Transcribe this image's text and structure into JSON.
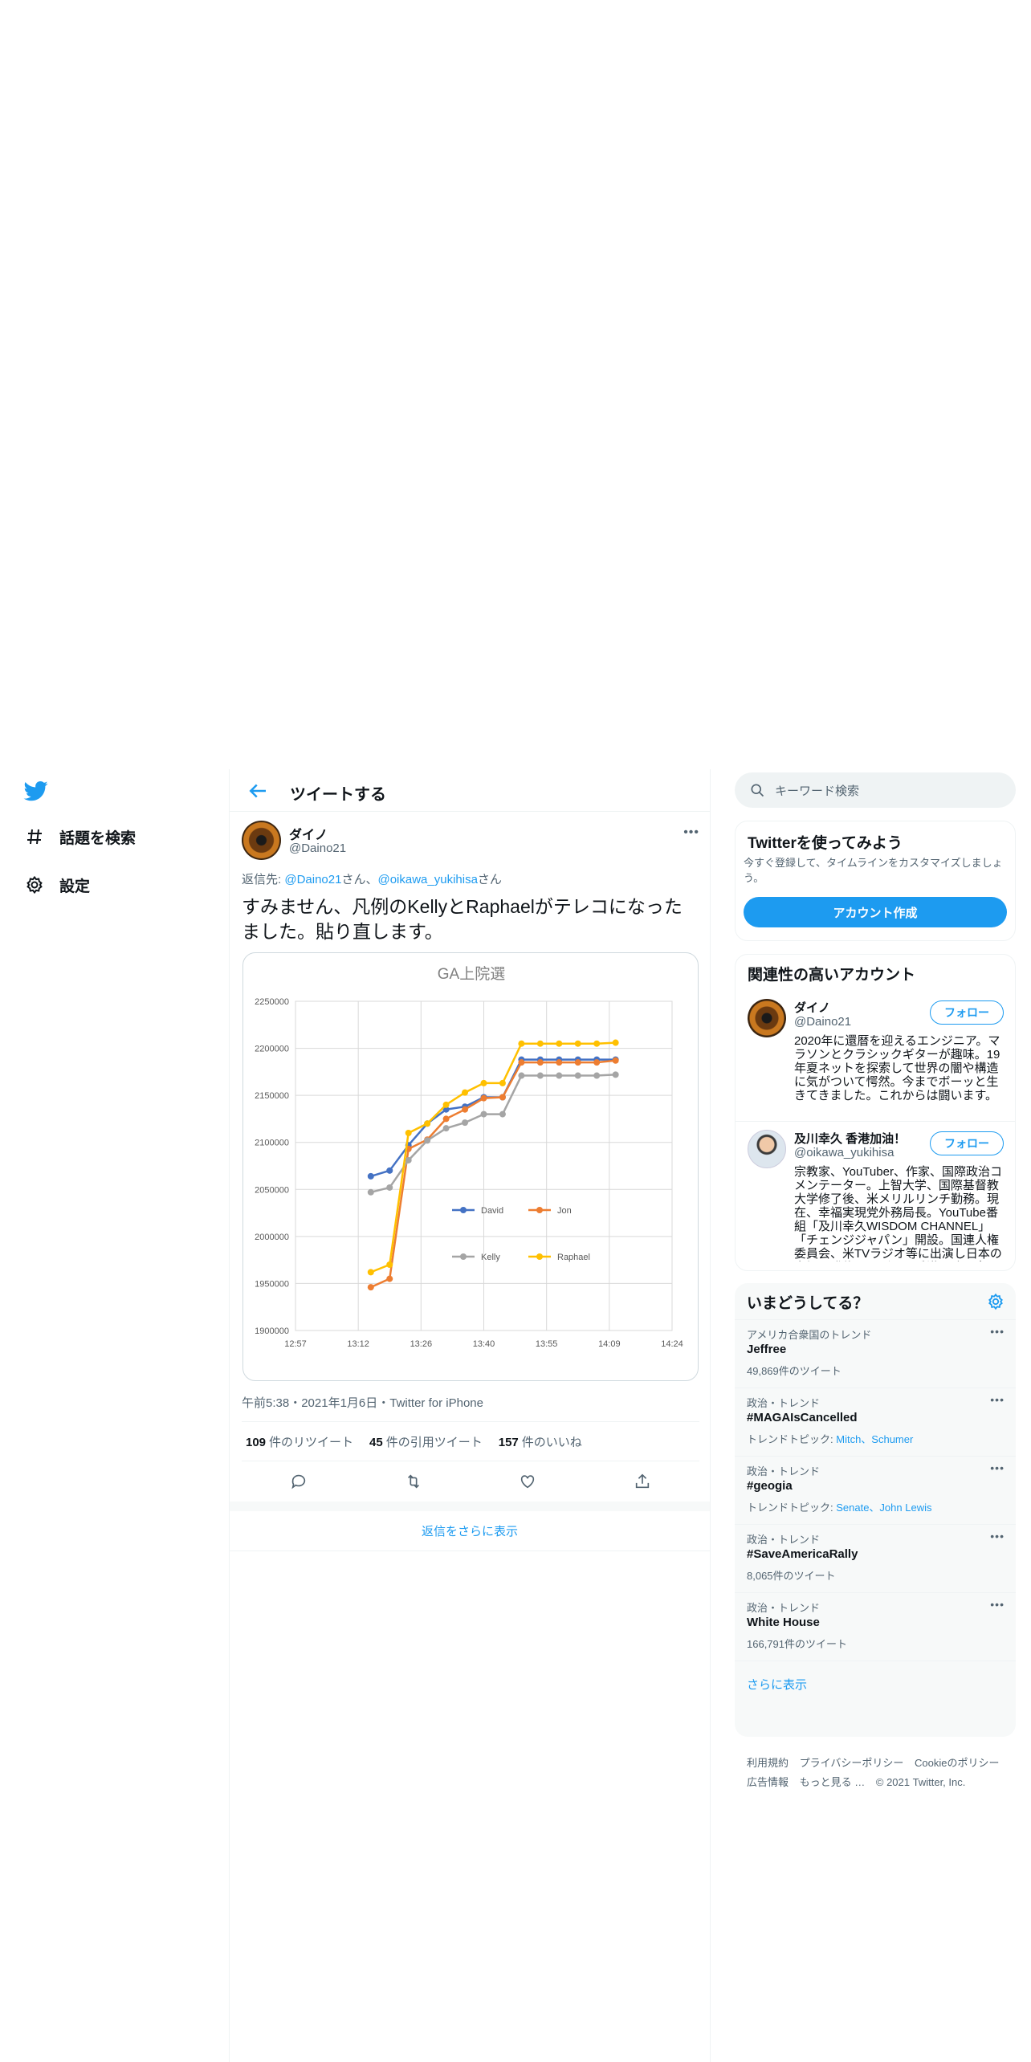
{
  "nav": {
    "items": [
      {
        "label": "話題を検索",
        "icon": "hashtag-icon"
      },
      {
        "label": "設定",
        "icon": "gear-icon"
      }
    ]
  },
  "header": {
    "title": "ツイートする"
  },
  "tweet": {
    "author_name": "ダイノ",
    "author_handle": "@Daino21",
    "replying_prefix": "返信先: ",
    "replying_to_1": "@Daino21",
    "replying_suffix_1": "さん、",
    "replying_to_2": "@oikawa_yukihisa",
    "replying_suffix_2": "さん",
    "text": "すみません、凡例のKellyとRaphaelがテレコになったました。貼り直します。",
    "timestamp": "午前5:38・2021年1月6日・Twitter for iPhone",
    "retweets_count": "109",
    "retweets_label": "件のリツイート",
    "quotes_count": "45",
    "quotes_label": "件の引用ツイート",
    "likes_count": "157",
    "likes_label": "件のいいね"
  },
  "show_more_replies": "返信をさらに表示",
  "search": {
    "placeholder": "キーワード検索"
  },
  "signup": {
    "title": "Twitterを使ってみよう",
    "desc": "今すぐ登録して、タイムラインをカスタマイズしましょう。",
    "button": "アカウント作成"
  },
  "related": {
    "title": "関連性の高いアカウント",
    "accounts": [
      {
        "name": "ダイノ",
        "handle": "@Daino21",
        "follow": "フォロー",
        "bio": "2020年に還暦を迎えるエンジニア。マラソンとクラシックギターが趣味。19年夏ネットを探索して世界の闇や構造に気がついて愕然。今までボーッと生きてきました。これからは闘います。"
      },
      {
        "name": "及川幸久 香港加油！",
        "handle": "@oikawa_yukihisa",
        "follow": "フォロー",
        "bio": "宗教家、YouTuber、作家、国際政治コメンテーター。上智大学、国際基督教大学修了後、米メリルリンチ勤務。現在、幸福実現党外務局長。YouTube番組「及川幸久WISDOM CHANNEL」「チェンジジャパン」開設。国連人権委員会、米TVラジオ等に出演し日本の立場を発信。しばらく香港の呟き多め"
      }
    ]
  },
  "trends": {
    "title": "いまどうしてる？",
    "items": [
      {
        "category": "アメリカ合衆国のトレンド",
        "name": "Jeffree",
        "sub": "49,869件のツイート"
      },
      {
        "category": "政治・トレンド",
        "name": "#MAGAIsCancelled",
        "sub_prefix": "トレンドトピック: ",
        "sub_links": "Mitch、Schumer"
      },
      {
        "category": "政治・トレンド",
        "name": "#geogia",
        "sub_prefix": "トレンドトピック: ",
        "sub_links": "Senate、John Lewis"
      },
      {
        "category": "政治・トレンド",
        "name": "#SaveAmericaRally",
        "sub": "8,065件のツイート"
      },
      {
        "category": "政治・トレンド",
        "name": "White House",
        "sub": "166,791件のツイート"
      }
    ],
    "more": "さらに表示"
  },
  "footer": {
    "links": [
      "利用規約",
      "プライバシーポリシー",
      "Cookieのポリシー",
      "広告情報",
      "もっと見る …",
      "© 2021 Twitter, Inc."
    ]
  },
  "colors": {
    "accent": "#1d9bf0",
    "text": "#0f1419",
    "muted": "#536471"
  },
  "chart_data": {
    "type": "line",
    "title": "GA上院選",
    "xlabel": "",
    "ylabel": "",
    "x_ticks": [
      "12:57",
      "13:12",
      "13:26",
      "13:40",
      "13:55",
      "14:09",
      "14:24"
    ],
    "ylim": [
      1900000,
      2250000
    ],
    "y_ticks": [
      1900000,
      1950000,
      2000000,
      2050000,
      2100000,
      2150000,
      2200000,
      2250000
    ],
    "grid": true,
    "legend_position": "center-right (inside plot)",
    "x_positions": [
      13.2,
      13.5,
      13.8,
      14.1,
      14.4,
      14.7,
      15.0,
      15.3,
      15.6,
      15.9,
      16.2,
      16.5,
      16.8,
      17.1,
      17.4,
      17.7
    ],
    "series": [
      {
        "name": "David",
        "color": "#4472c4",
        "values": [
          2064000,
          2070000,
          2097000,
          2120000,
          2135000,
          2138000,
          2148000,
          2148000,
          2188000,
          2188000,
          2188000,
          2188000,
          2188000,
          2188000,
          null,
          null
        ]
      },
      {
        "name": "Jon",
        "color": "#ed7d31",
        "values": [
          1946000,
          1955000,
          2093000,
          2103000,
          2125000,
          2135000,
          2147000,
          2148000,
          2185000,
          2185000,
          2185000,
          2185000,
          2185000,
          2187000,
          null,
          null
        ]
      },
      {
        "name": "Kelly",
        "color": "#a5a5a5",
        "values": [
          2047000,
          2052000,
          2081000,
          2102000,
          2115000,
          2121000,
          2130000,
          2130000,
          2171000,
          2171000,
          2171000,
          2171000,
          2171000,
          2172000,
          null,
          null
        ]
      },
      {
        "name": "Raphael",
        "color": "#ffc000",
        "values": [
          1962000,
          1970000,
          2110000,
          2120000,
          2140000,
          2153000,
          2163000,
          2163000,
          2205000,
          2205000,
          2205000,
          2205000,
          2205000,
          2206000,
          null,
          null
        ]
      }
    ]
  }
}
